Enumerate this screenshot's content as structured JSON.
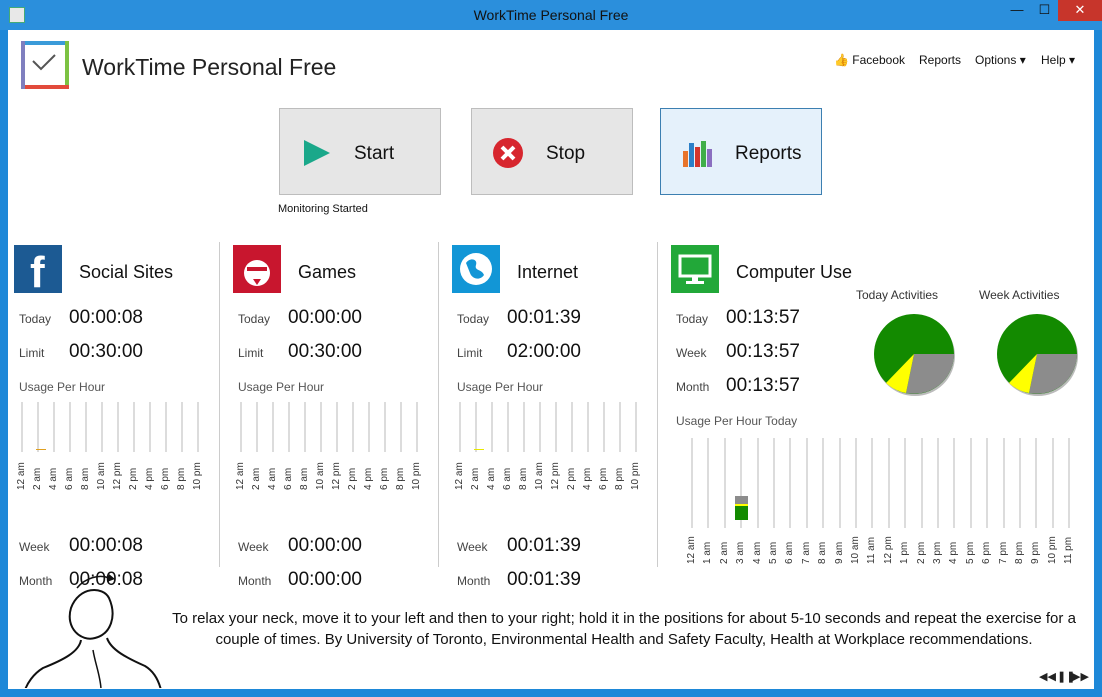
{
  "window": {
    "title": "WorkTime Personal Free",
    "min": "—",
    "max": "☐",
    "close": "✕"
  },
  "app": {
    "title": "WorkTime Personal Free"
  },
  "nav": {
    "facebook": "Facebook",
    "reports": "Reports",
    "options": "Options ▾",
    "help": "Help ▾"
  },
  "buttons": {
    "start": "Start",
    "stop": "Stop",
    "reports": "Reports"
  },
  "status": "Monitoring Started",
  "colors": {
    "accent": "#2b8fdc",
    "facebook": "#1c5a93",
    "games": "#c8162e",
    "internet": "#1296d6",
    "computer": "#22a839",
    "pieGreen": "#138a00",
    "pieGray": "#8c8c8c",
    "pieYellow": "#ffff00"
  },
  "panels": [
    {
      "icon": "facebook-icon",
      "title": "Social Sites",
      "rows": [
        {
          "label": "Today",
          "value": "00:00:08"
        },
        {
          "label": "Limit",
          "value": "00:30:00"
        }
      ],
      "usage_label": "Usage Per Hour",
      "bottom": [
        {
          "label": "Week",
          "value": "00:00:08"
        },
        {
          "label": "Month",
          "value": "00:00:08"
        }
      ]
    },
    {
      "icon": "angry-bird-icon",
      "title": "Games",
      "rows": [
        {
          "label": "Today",
          "value": "00:00:00"
        },
        {
          "label": "Limit",
          "value": "00:30:00"
        }
      ],
      "usage_label": "Usage Per Hour",
      "bottom": [
        {
          "label": "Week",
          "value": "00:00:00"
        },
        {
          "label": "Month",
          "value": "00:00:00"
        }
      ]
    },
    {
      "icon": "globe-icon",
      "title": "Internet",
      "rows": [
        {
          "label": "Today",
          "value": "00:01:39"
        },
        {
          "label": "Limit",
          "value": "02:00:00"
        }
      ],
      "usage_label": "Usage Per Hour",
      "bottom": [
        {
          "label": "Week",
          "value": "00:01:39"
        },
        {
          "label": "Month",
          "value": "00:01:39"
        }
      ]
    }
  ],
  "hour_ticks_2h": [
    "12 am",
    "2 am",
    "4 am",
    "6 am",
    "8 am",
    "10 am",
    "12 pm",
    "2 pm",
    "4 pm",
    "6 pm",
    "8 pm",
    "10 pm"
  ],
  "computer": {
    "title": "Computer Use",
    "rows": [
      {
        "label": "Today",
        "value": "00:13:57"
      },
      {
        "label": "Week",
        "value": "00:13:57"
      },
      {
        "label": "Month",
        "value": "00:13:57"
      }
    ],
    "today_activities": "Today Activities",
    "week_activities": "Week Activities",
    "usage_label": "Usage Per Hour Today",
    "hour_ticks": [
      "12 am",
      "1 am",
      "2 am",
      "3 am",
      "4 am",
      "5 am",
      "6 am",
      "7 am",
      "8 am",
      "9 am",
      "10 am",
      "11 am",
      "12 pm",
      "1 pm",
      "2 pm",
      "3 pm",
      "4 pm",
      "5 pm",
      "6 pm",
      "7 pm",
      "8 pm",
      "9 pm",
      "10 pm",
      "11 pm"
    ]
  },
  "tip": "To relax your neck, move it to your left and then to your right; hold it in the positions for about 5-10 seconds and repeat the exercise for a couple of times. By University of Toronto, Environmental Health and Safety Faculty, Health at Workplace recommendations.",
  "media": {
    "prev": "◀◀",
    "pause": "❚❚",
    "next": "▶▶"
  }
}
